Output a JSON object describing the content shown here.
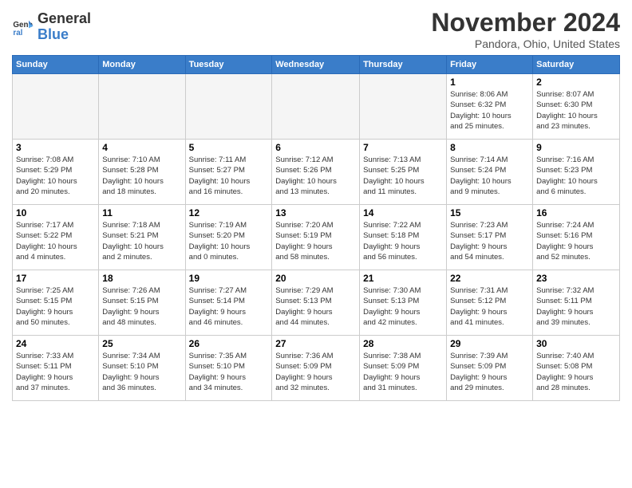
{
  "logo": {
    "line1": "General",
    "line2": "Blue"
  },
  "title": "November 2024",
  "location": "Pandora, Ohio, United States",
  "days_of_week": [
    "Sunday",
    "Monday",
    "Tuesday",
    "Wednesday",
    "Thursday",
    "Friday",
    "Saturday"
  ],
  "weeks": [
    [
      {
        "day": "",
        "info": ""
      },
      {
        "day": "",
        "info": ""
      },
      {
        "day": "",
        "info": ""
      },
      {
        "day": "",
        "info": ""
      },
      {
        "day": "",
        "info": ""
      },
      {
        "day": "1",
        "info": "Sunrise: 8:06 AM\nSunset: 6:32 PM\nDaylight: 10 hours\nand 25 minutes."
      },
      {
        "day": "2",
        "info": "Sunrise: 8:07 AM\nSunset: 6:30 PM\nDaylight: 10 hours\nand 23 minutes."
      }
    ],
    [
      {
        "day": "3",
        "info": "Sunrise: 7:08 AM\nSunset: 5:29 PM\nDaylight: 10 hours\nand 20 minutes."
      },
      {
        "day": "4",
        "info": "Sunrise: 7:10 AM\nSunset: 5:28 PM\nDaylight: 10 hours\nand 18 minutes."
      },
      {
        "day": "5",
        "info": "Sunrise: 7:11 AM\nSunset: 5:27 PM\nDaylight: 10 hours\nand 16 minutes."
      },
      {
        "day": "6",
        "info": "Sunrise: 7:12 AM\nSunset: 5:26 PM\nDaylight: 10 hours\nand 13 minutes."
      },
      {
        "day": "7",
        "info": "Sunrise: 7:13 AM\nSunset: 5:25 PM\nDaylight: 10 hours\nand 11 minutes."
      },
      {
        "day": "8",
        "info": "Sunrise: 7:14 AM\nSunset: 5:24 PM\nDaylight: 10 hours\nand 9 minutes."
      },
      {
        "day": "9",
        "info": "Sunrise: 7:16 AM\nSunset: 5:23 PM\nDaylight: 10 hours\nand 6 minutes."
      }
    ],
    [
      {
        "day": "10",
        "info": "Sunrise: 7:17 AM\nSunset: 5:22 PM\nDaylight: 10 hours\nand 4 minutes."
      },
      {
        "day": "11",
        "info": "Sunrise: 7:18 AM\nSunset: 5:21 PM\nDaylight: 10 hours\nand 2 minutes."
      },
      {
        "day": "12",
        "info": "Sunrise: 7:19 AM\nSunset: 5:20 PM\nDaylight: 10 hours\nand 0 minutes."
      },
      {
        "day": "13",
        "info": "Sunrise: 7:20 AM\nSunset: 5:19 PM\nDaylight: 9 hours\nand 58 minutes."
      },
      {
        "day": "14",
        "info": "Sunrise: 7:22 AM\nSunset: 5:18 PM\nDaylight: 9 hours\nand 56 minutes."
      },
      {
        "day": "15",
        "info": "Sunrise: 7:23 AM\nSunset: 5:17 PM\nDaylight: 9 hours\nand 54 minutes."
      },
      {
        "day": "16",
        "info": "Sunrise: 7:24 AM\nSunset: 5:16 PM\nDaylight: 9 hours\nand 52 minutes."
      }
    ],
    [
      {
        "day": "17",
        "info": "Sunrise: 7:25 AM\nSunset: 5:15 PM\nDaylight: 9 hours\nand 50 minutes."
      },
      {
        "day": "18",
        "info": "Sunrise: 7:26 AM\nSunset: 5:15 PM\nDaylight: 9 hours\nand 48 minutes."
      },
      {
        "day": "19",
        "info": "Sunrise: 7:27 AM\nSunset: 5:14 PM\nDaylight: 9 hours\nand 46 minutes."
      },
      {
        "day": "20",
        "info": "Sunrise: 7:29 AM\nSunset: 5:13 PM\nDaylight: 9 hours\nand 44 minutes."
      },
      {
        "day": "21",
        "info": "Sunrise: 7:30 AM\nSunset: 5:13 PM\nDaylight: 9 hours\nand 42 minutes."
      },
      {
        "day": "22",
        "info": "Sunrise: 7:31 AM\nSunset: 5:12 PM\nDaylight: 9 hours\nand 41 minutes."
      },
      {
        "day": "23",
        "info": "Sunrise: 7:32 AM\nSunset: 5:11 PM\nDaylight: 9 hours\nand 39 minutes."
      }
    ],
    [
      {
        "day": "24",
        "info": "Sunrise: 7:33 AM\nSunset: 5:11 PM\nDaylight: 9 hours\nand 37 minutes."
      },
      {
        "day": "25",
        "info": "Sunrise: 7:34 AM\nSunset: 5:10 PM\nDaylight: 9 hours\nand 36 minutes."
      },
      {
        "day": "26",
        "info": "Sunrise: 7:35 AM\nSunset: 5:10 PM\nDaylight: 9 hours\nand 34 minutes."
      },
      {
        "day": "27",
        "info": "Sunrise: 7:36 AM\nSunset: 5:09 PM\nDaylight: 9 hours\nand 32 minutes."
      },
      {
        "day": "28",
        "info": "Sunrise: 7:38 AM\nSunset: 5:09 PM\nDaylight: 9 hours\nand 31 minutes."
      },
      {
        "day": "29",
        "info": "Sunrise: 7:39 AM\nSunset: 5:09 PM\nDaylight: 9 hours\nand 29 minutes."
      },
      {
        "day": "30",
        "info": "Sunrise: 7:40 AM\nSunset: 5:08 PM\nDaylight: 9 hours\nand 28 minutes."
      }
    ]
  ]
}
